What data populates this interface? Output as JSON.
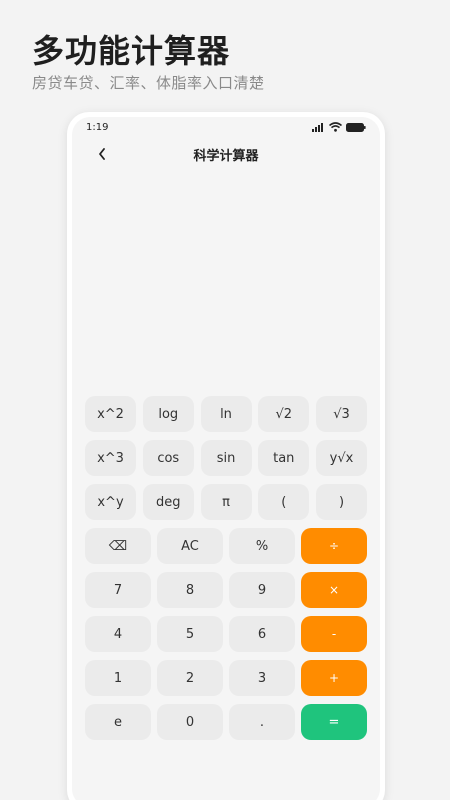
{
  "promo": {
    "title": "多功能计算器",
    "subtitle": "房贷车贷、汇率、体脂率入口清楚"
  },
  "status_bar": {
    "time": "1:19",
    "icons": [
      "signal-icon",
      "wifi-icon",
      "battery-icon"
    ]
  },
  "nav": {
    "back_icon": "chevron-left-icon",
    "title": "科学计算器"
  },
  "display": {
    "expression": "",
    "result": ""
  },
  "colors": {
    "operator": "#ff8c00",
    "equals": "#1fc47d",
    "key": "#ebebeb",
    "screen": "#f5f5f5"
  },
  "keypad": {
    "scientific_rows": [
      [
        "x^2",
        "log",
        "ln",
        "√2",
        "√3"
      ],
      [
        "x^3",
        "cos",
        "sin",
        "tan",
        "y√x"
      ],
      [
        "x^y",
        "deg",
        "π",
        "(",
        ")"
      ]
    ],
    "standard_rows": [
      [
        "⌫",
        "AC",
        "%",
        "÷"
      ],
      [
        "7",
        "8",
        "9",
        "×"
      ],
      [
        "4",
        "5",
        "6",
        "-"
      ],
      [
        "1",
        "2",
        "3",
        "+"
      ],
      [
        "e",
        "0",
        ".",
        "="
      ]
    ]
  }
}
